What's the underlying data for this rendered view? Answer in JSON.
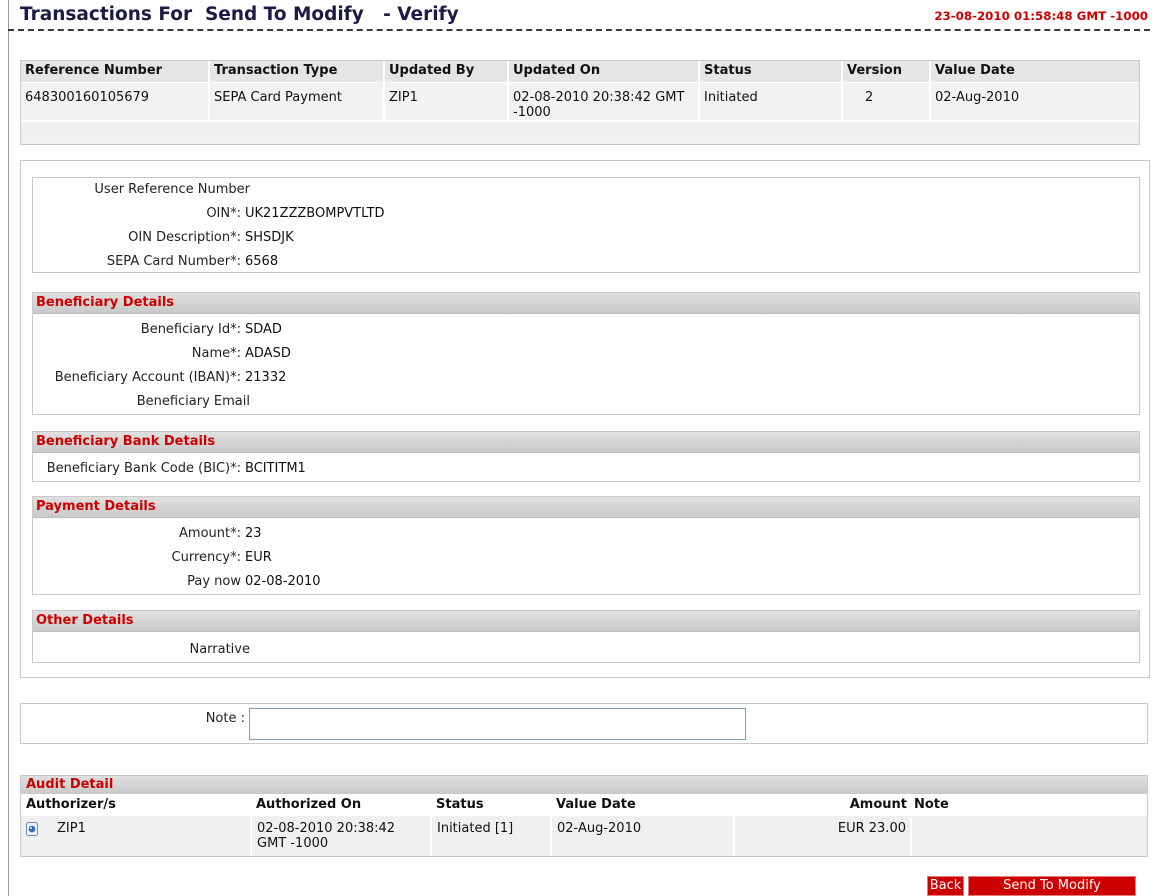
{
  "header": {
    "title": "Transactions For  Send To Modify   - Verify",
    "timestamp": "23-08-2010 01:58:48 GMT -1000"
  },
  "summary": {
    "columns": {
      "reference_number": "Reference Number",
      "transaction_type": "Transaction Type",
      "updated_by": "Updated By",
      "updated_on": "Updated On",
      "status": "Status",
      "version": "Version",
      "value_date": "Value Date"
    },
    "rows": [
      {
        "reference_number": "648300160105679",
        "transaction_type": "SEPA Card Payment",
        "updated_by": "ZIP1",
        "updated_on": "02-08-2010 20:38:42 GMT -1000",
        "status": "Initiated",
        "version": "2",
        "value_date": "02-Aug-2010"
      }
    ]
  },
  "details": {
    "general": [
      {
        "label": "User Reference Number"
      },
      {
        "label": "OIN*:",
        "value": "UK21ZZZBOMPVTLTD"
      },
      {
        "label": "OIN Description*:",
        "value": "SHSDJK"
      },
      {
        "label": "SEPA Card Number*:",
        "value": "6568"
      }
    ],
    "beneficiary": {
      "title": "Beneficiary Details",
      "fields": [
        {
          "label": "Beneficiary Id*:",
          "value": "SDAD"
        },
        {
          "label": "Name*:",
          "value": "ADASD"
        },
        {
          "label": "Beneficiary Account (IBAN)*:",
          "value": "21332"
        },
        {
          "label": "Beneficiary Email"
        }
      ]
    },
    "beneficiary_bank": {
      "title": "Beneficiary Bank Details",
      "fields": [
        {
          "label": "Beneficiary Bank Code (BIC)*:",
          "value": "BCITITM1"
        }
      ]
    },
    "payment": {
      "title": "Payment Details",
      "fields": [
        {
          "label": "Amount*:",
          "value": "23"
        },
        {
          "label": "Currency*:",
          "value": "EUR"
        },
        {
          "label": "Pay now",
          "value": "02-08-2010"
        }
      ]
    },
    "other": {
      "title": "Other Details",
      "fields": [
        {
          "label": "Narrative"
        }
      ]
    }
  },
  "note": {
    "label": "Note :"
  },
  "audit": {
    "title": "Audit Detail",
    "columns": {
      "authorizer": "Authorizer/s",
      "authorized_on": "Authorized On",
      "status": "Status",
      "value_date": "Value Date",
      "amount": "Amount",
      "note": "Note"
    },
    "rows": [
      {
        "authorizer": "ZIP1",
        "authorized_on": "02-08-2010 20:38:42 GMT -1000",
        "status": "Initiated [1]",
        "value_date": "02-Aug-2010",
        "amount": "EUR 23.00"
      }
    ]
  },
  "buttons": {
    "back": "Back",
    "send_to_modify": "Send To Modify"
  },
  "icons": {
    "audit_row_action": "document-view-icon"
  },
  "colors": {
    "accent_red": "#cc0000",
    "title_text": "#1b1b46",
    "button_bg": "#cc0000",
    "section_bar": "#d2d2d2"
  }
}
